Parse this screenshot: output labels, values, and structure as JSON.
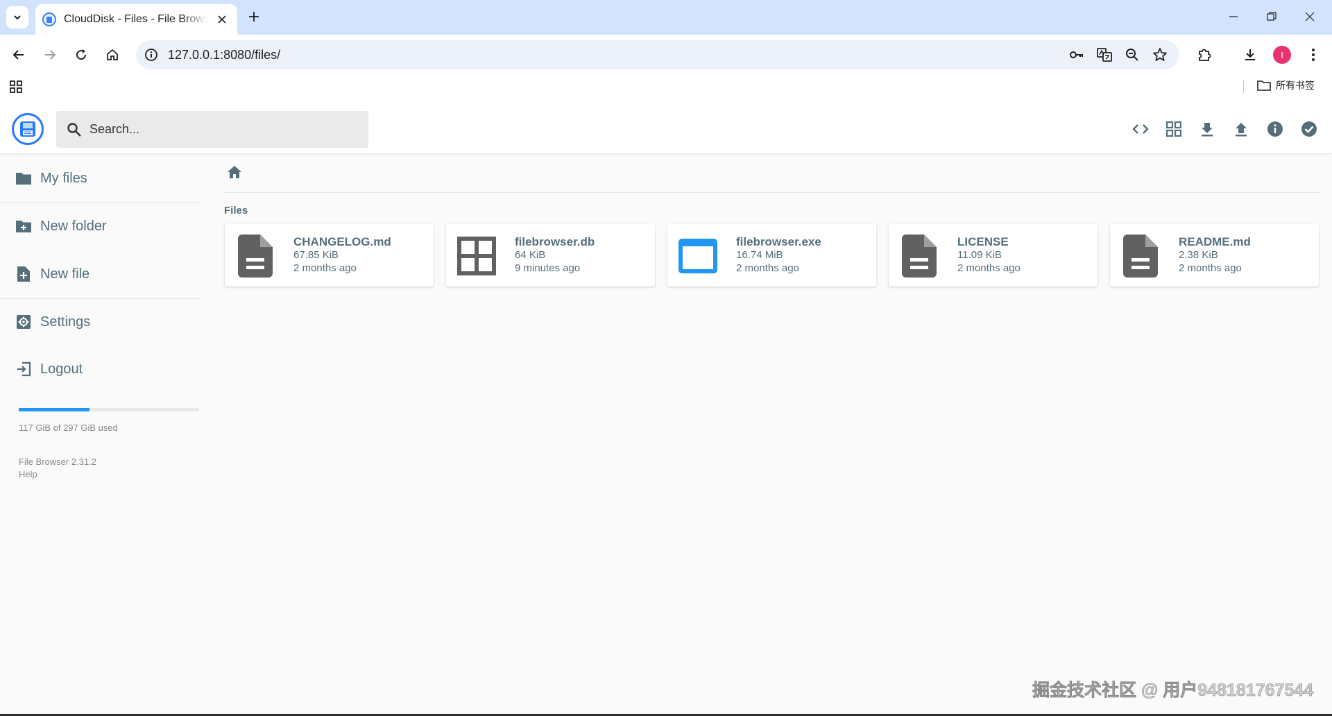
{
  "browser": {
    "tab_title": "CloudDisk - Files - File Browser",
    "url": "127.0.0.1:8080/files/",
    "profile_initial": "I",
    "bookmarks_all_label": "所有书签"
  },
  "app": {
    "search_placeholder": "Search...",
    "header_actions": [
      "code-icon",
      "grid-view-icon",
      "download-icon",
      "upload-icon",
      "info-icon",
      "select-check-icon"
    ]
  },
  "sidebar": {
    "items": [
      {
        "label": "My files",
        "icon": "folder-icon"
      },
      {
        "label": "New folder",
        "icon": "create-new-folder-icon"
      },
      {
        "label": "New file",
        "icon": "note-add-icon"
      },
      {
        "label": "Settings",
        "icon": "settings-icon"
      },
      {
        "label": "Logout",
        "icon": "exit-icon"
      }
    ],
    "usage_fraction": 0.394,
    "usage_text": "117 GiB of 297 GiB used",
    "version": "File Browser 2.31.2",
    "help": "Help"
  },
  "listing": {
    "section_title": "Files",
    "files": [
      {
        "name": "CHANGELOG.md",
        "size": "67.85 KiB",
        "modified": "2 months ago",
        "icon": "description-icon"
      },
      {
        "name": "filebrowser.db",
        "size": "64 KiB",
        "modified": "9 minutes ago",
        "icon": "grid-file-icon"
      },
      {
        "name": "filebrowser.exe",
        "size": "16.74 MiB",
        "modified": "2 months ago",
        "icon": "application-icon"
      },
      {
        "name": "LICENSE",
        "size": "11.09 KiB",
        "modified": "2 months ago",
        "icon": "description-icon"
      },
      {
        "name": "README.md",
        "size": "2.38 KiB",
        "modified": "2 months ago",
        "icon": "description-icon"
      }
    ]
  },
  "colors": {
    "accent": "#2196f3",
    "icon_gray": "#616161",
    "text": "#546e7a"
  },
  "watermark": "掘金技术社区 @ 用户948181767544"
}
